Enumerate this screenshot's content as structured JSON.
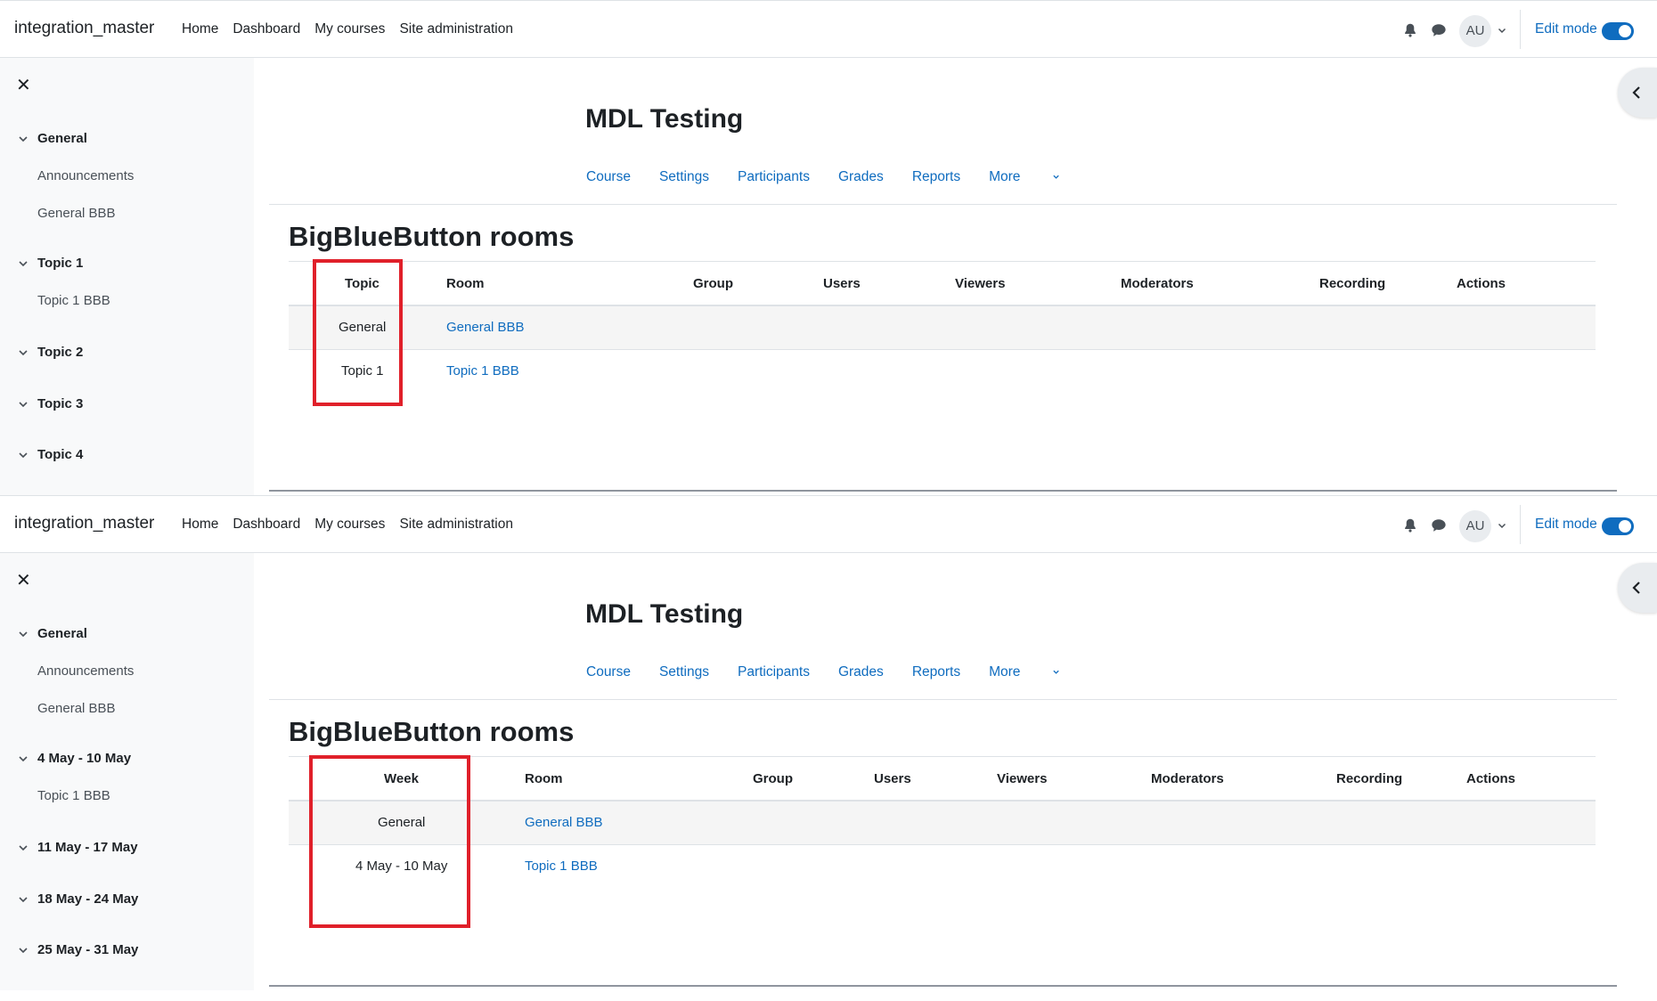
{
  "panels": [
    {
      "navbar": {
        "brand": "integration_master",
        "links": [
          "Home",
          "Dashboard",
          "My courses",
          "Site administration"
        ],
        "avatar": "AU",
        "edit_mode_label": "Edit mode",
        "edit_mode_on": true
      },
      "drawer": {
        "items": [
          {
            "type": "section",
            "label": "General"
          },
          {
            "type": "activity",
            "label": "Announcements"
          },
          {
            "type": "activity",
            "label": "General BBB"
          },
          {
            "type": "section",
            "label": "Topic 1"
          },
          {
            "type": "activity",
            "label": "Topic 1 BBB"
          },
          {
            "type": "section",
            "label": "Topic 2"
          },
          {
            "type": "section",
            "label": "Topic 3"
          },
          {
            "type": "section",
            "label": "Topic 4"
          }
        ]
      },
      "course": {
        "title": "MDL Testing",
        "nav": [
          "Course",
          "Settings",
          "Participants",
          "Grades",
          "Reports",
          "More"
        ]
      },
      "section_title": "BigBlueButton rooms",
      "table": {
        "headers": [
          "Topic",
          "Room",
          "Group",
          "Users",
          "Viewers",
          "Moderators",
          "Recording",
          "Actions"
        ],
        "rows": [
          [
            "General",
            "General BBB"
          ],
          [
            "Topic 1",
            "Topic 1 BBB"
          ]
        ]
      }
    },
    {
      "navbar": {
        "brand": "integration_master",
        "links": [
          "Home",
          "Dashboard",
          "My courses",
          "Site administration"
        ],
        "avatar": "AU",
        "edit_mode_label": "Edit mode",
        "edit_mode_on": true
      },
      "drawer": {
        "items": [
          {
            "type": "section",
            "label": "General"
          },
          {
            "type": "activity",
            "label": "Announcements"
          },
          {
            "type": "activity",
            "label": "General BBB"
          },
          {
            "type": "section",
            "label": "4 May - 10 May"
          },
          {
            "type": "activity",
            "label": "Topic 1 BBB"
          },
          {
            "type": "section",
            "label": "11 May - 17 May"
          },
          {
            "type": "section",
            "label": "18 May - 24 May"
          },
          {
            "type": "section",
            "label": "25 May - 31 May"
          }
        ]
      },
      "course": {
        "title": "MDL Testing",
        "nav": [
          "Course",
          "Settings",
          "Participants",
          "Grades",
          "Reports",
          "More"
        ]
      },
      "section_title": "BigBlueButton rooms",
      "table": {
        "headers": [
          "Week",
          "Room",
          "Group",
          "Users",
          "Viewers",
          "Moderators",
          "Recording",
          "Actions"
        ],
        "rows": [
          [
            "General",
            "General BBB"
          ],
          [
            "4 May - 10 May",
            "Topic 1 BBB"
          ]
        ]
      }
    }
  ],
  "colors": {
    "link": "#0f6cbf",
    "highlight_box": "#e0202a",
    "drawer_bg": "#f8f9fa",
    "striped_row": "#f5f5f5"
  }
}
